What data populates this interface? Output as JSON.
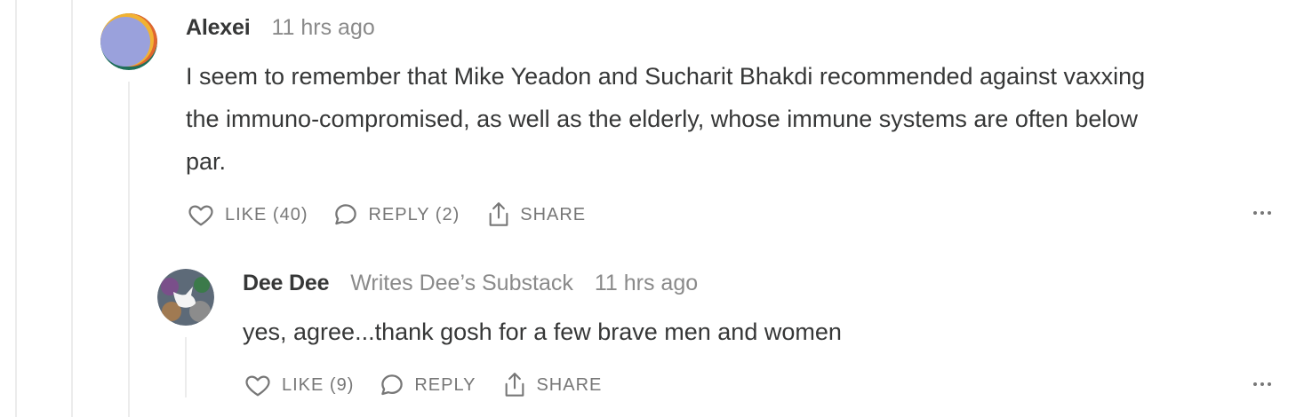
{
  "comments": [
    {
      "author": "Alexei",
      "time": "11 hrs ago",
      "lines": [
        "I seem to remember that Mike Yeadon and Sucharit Bhakdi recommended against vaxxing",
        "the immuno-compromised, as well as the elderly, whose immune systems are often below",
        "par."
      ],
      "like_label": "LIKE (40)",
      "reply_label": "REPLY (2)",
      "share_label": "SHARE",
      "icons": [
        "heart-icon",
        "speech-bubble-icon",
        "share-icon",
        "more-icon"
      ]
    },
    {
      "author": "Dee Dee",
      "writes": "Writes Dee’s Substack",
      "time": "11 hrs ago",
      "text": "yes, agree...thank gosh for a few brave men and women",
      "like_label": "LIKE (9)",
      "reply_label": "REPLY",
      "share_label": "SHARE",
      "icons": [
        "heart-icon",
        "speech-bubble-icon",
        "share-icon",
        "more-icon"
      ]
    }
  ],
  "colors": {
    "text": "#363737",
    "muted": "#8a8a8a",
    "action": "#777777",
    "thread_line": "#ececec"
  }
}
